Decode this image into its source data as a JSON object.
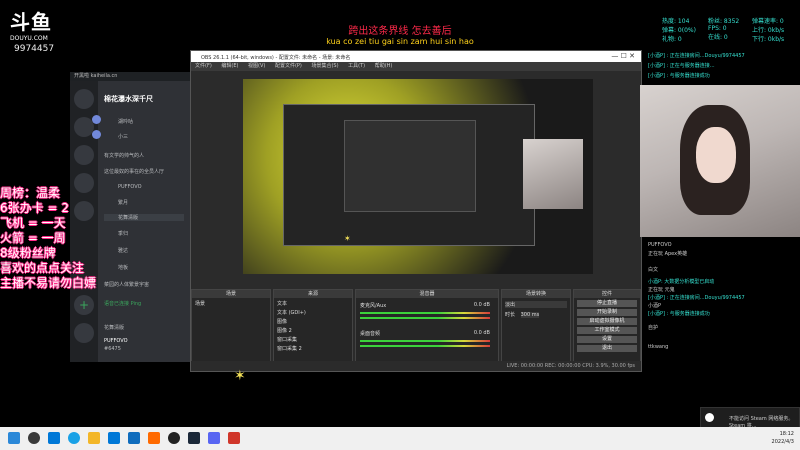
{
  "stream": {
    "logo_text": "斗鱼",
    "logo_sub": "DOUYU.COM",
    "room_id": "9974457",
    "lyric_cn": "跨出这条界线 怎去善后",
    "lyric_roman": "kua co zei tiu gai sin zam hui sin hao"
  },
  "stats": {
    "left_col": [
      "热度: 104",
      "弹幕: 0(0%)",
      "礼物: 0"
    ],
    "mid_col": [
      "粉丝: 8352",
      "FPS: 0",
      "在线: 0"
    ],
    "right_col": [
      "弹幕速率: 0",
      "上行: 0kb/s",
      "下行: 0kb/s"
    ]
  },
  "discord": {
    "top_bar": "开黑啦  kaiheila.cn",
    "server_name": "棉花瀑水深千尺",
    "channels": [
      "湖吟咕",
      "小三",
      "有文学的帅气的人",
      "这位最奴的事在的全员人厅",
      "PUFFOVO",
      "繁月",
      "花舞清版",
      "季归",
      "雅达",
      "地板",
      "菜园的人体繁景宇宙"
    ],
    "voice_status": "语音已连接 Ping",
    "voice_channel": "花舞清版",
    "user_name": "PUFFOVO",
    "user_tag": "#6475"
  },
  "obs": {
    "title": "OBS 26.1.1 (64-bit, windows) - 配置文件: 未命名 - 场景: 未命名",
    "menu": [
      "文件(F)",
      "编辑(E)",
      "视图(V)",
      "配置文件(P)",
      "场景集合(S)",
      "工具(T)",
      "帮助(H)"
    ],
    "docks": {
      "scenes": "场景",
      "sources": "来源",
      "mixer": "混音器",
      "transitions": "场景转换",
      "controls": "控件"
    },
    "sources": [
      "文本",
      "文本 (GDI+)",
      "图像",
      "图像 2",
      "窗口采集",
      "窗口采集 2"
    ],
    "scenes": [
      "场景"
    ],
    "mixer": [
      {
        "name": "麦克风/Aux",
        "db": "0.0 dB"
      },
      {
        "name": "桌面音频",
        "db": "0.0 dB"
      }
    ],
    "transition": {
      "type": "淡出",
      "duration_label": "时长",
      "duration": "300 ms"
    },
    "controls": [
      "停止直播",
      "开始录制",
      "启动虚拟摄像机",
      "工作室模式",
      "设置",
      "退出"
    ],
    "status": "LIVE: 00:00:00   REC: 00:00:00   CPU: 3.9%, 30.00 fps"
  },
  "chat": [
    {
      "text": "[小酒P] : 正在连接房间...Douyu/9974457",
      "cls": "c"
    },
    {
      "text": "[小酒P] : 正在与服务器连接...",
      "cls": "c"
    },
    {
      "text": "[小酒P] : 与服务器连接成功",
      "cls": "c"
    },
    {
      "text": "PUFFOVO",
      "cls": "w"
    },
    {
      "text": "正在玩 Apex英雄",
      "cls": "w"
    },
    {
      "text": "白文",
      "cls": "w"
    },
    {
      "text": "小酒P: 大数据分析模型已启动",
      "cls": "c"
    },
    {
      "text": "正在玩 元鬼",
      "cls": "w"
    },
    {
      "text": "[小酒P] : 正在连接房间...Douyu/9974457",
      "cls": "c"
    },
    {
      "text": "小酒P",
      "cls": "w"
    },
    {
      "text": "[小酒P] : 与服务器连接成功",
      "cls": "c"
    },
    {
      "text": "自护",
      "cls": "w"
    },
    {
      "text": "ttkwang",
      "cls": "w"
    }
  ],
  "rank_overlay": [
    "周榜：温柔",
    "6张办卡 = 2",
    "飞机 = 一天",
    "火箭 = 一周",
    "8级粉丝牌",
    "喜欢的点点关注",
    "主播不易请勿白嫖"
  ],
  "toast": "不能访问 Steam 网络服务。Steam 将...",
  "clock": {
    "time": "18:12",
    "date": "2022/4/3"
  },
  "taskbar_icons": [
    "start-icon",
    "search-icon",
    "taskview-icon",
    "edge-icon",
    "explorer-icon",
    "store-icon",
    "mail-icon",
    "douyu-icon",
    "obs-icon",
    "steam-icon",
    "discord-icon",
    "apex-icon"
  ]
}
